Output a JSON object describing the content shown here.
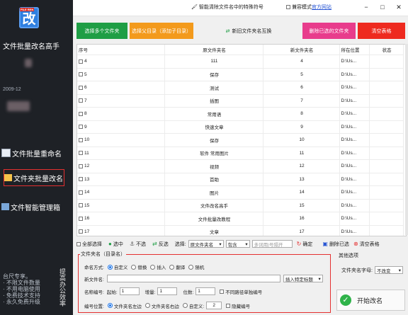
{
  "app": {
    "logo_text": "改",
    "logo_tag": "FILE REN",
    "title": "文件批量改名高手",
    "user_fragment": "2009-12"
  },
  "sidebar": {
    "items": [
      {
        "label": "文件批量重命名"
      },
      {
        "label": "文件夹批量改名"
      },
      {
        "label": "文件智能管理箱"
      }
    ],
    "notes": [
      "台尺专享。",
      "· 不限文件数量",
      "· 不用电脑使用",
      "· 免费技术支持",
      "· 永久免费升级"
    ],
    "vertical": "提高办公效率"
  },
  "topbar": {
    "smart_label": "智能清除文件名中的特殊符号",
    "compat_label": "兼容模式",
    "official_label": "官方网站",
    "win_buttons": [
      "−",
      "□",
      "✕"
    ]
  },
  "actions": [
    {
      "label": "选择多个文件夹",
      "color": "#1f9e45"
    },
    {
      "label": "选择父目录（添加子目录）",
      "color": "#f39a1c"
    },
    {
      "label": "新旧文件夹名互换",
      "color": "#f0f0f0"
    },
    {
      "label": "删除已选的文件夹",
      "color": "#e83c8c"
    },
    {
      "label": "清空表格",
      "color": "#ee2a1f"
    }
  ],
  "table": {
    "headers": [
      "序号",
      "原文件夹名",
      "新文件夹名",
      "所在位置",
      "状态"
    ],
    "rows": [
      {
        "no": "4",
        "old": "111",
        "new": "4",
        "loc": "D:\\Us..."
      },
      {
        "no": "5",
        "old": "保存",
        "new": "5",
        "loc": "D:\\Us..."
      },
      {
        "no": "6",
        "old": "测试",
        "new": "6",
        "loc": "D:\\Us..."
      },
      {
        "no": "7",
        "old": "插图",
        "new": "7",
        "loc": "D:\\Us..."
      },
      {
        "no": "8",
        "old": "常用语",
        "new": "8",
        "loc": "D:\\Us..."
      },
      {
        "no": "9",
        "old": "快速文章",
        "new": "9",
        "loc": "D:\\Us..."
      },
      {
        "no": "10",
        "old": "保存",
        "new": "10",
        "loc": "D:\\Us..."
      },
      {
        "no": "11",
        "old": "软件 常用图片",
        "new": "11",
        "loc": "D:\\Us..."
      },
      {
        "no": "12",
        "old": "视频",
        "new": "12",
        "loc": "D:\\Us..."
      },
      {
        "no": "13",
        "old": "首助",
        "new": "13",
        "loc": "D:\\Us..."
      },
      {
        "no": "14",
        "old": "图片",
        "new": "14",
        "loc": "D:\\Us..."
      },
      {
        "no": "15",
        "old": "文件改名高手",
        "new": "15",
        "loc": "D:\\Us..."
      },
      {
        "no": "16",
        "old": "文件批量改教程",
        "new": "16",
        "loc": "D:\\Us..."
      },
      {
        "no": "17",
        "old": "文章",
        "new": "17",
        "loc": "D:\\Us..."
      }
    ]
  },
  "toolbar": {
    "select_all": "全部选择",
    "select": "选中",
    "unselect": "不选",
    "invert": "反选",
    "select_label": "选择:",
    "field_value": "原文件夹名",
    "match_value": "包含",
    "input_placeholder": "多词用|号隔开",
    "confirm": "确定",
    "delete_selected": "删除已选",
    "clear_table": "清空表格"
  },
  "naming": {
    "legend": "文件夹名（目录名）",
    "method_label": "命名方式:",
    "methods": [
      "自定义",
      "替换",
      "插入",
      "翻译",
      "随机"
    ],
    "new_name_label": "新文件名:",
    "insert_title": "插入特定标题",
    "number_label": "名称编号:",
    "start_label": "起始:",
    "start_value": "1",
    "step_label": "增量:",
    "step_value": "1",
    "digits_label": "位数:",
    "digits_value": "1",
    "no_dup_label": "不同路径单独编号",
    "pos_label": "编号位置:",
    "positions": [
      "文件夹名左边",
      "文件夹名右边",
      "自定义:"
    ],
    "custom_pos": "2",
    "hide_number": "隐藏编号"
  },
  "other": {
    "title": "其他选项",
    "case_label": "文件夹名字母:",
    "case_value": "不改变"
  },
  "start_button": {
    "label": "开始改名"
  }
}
